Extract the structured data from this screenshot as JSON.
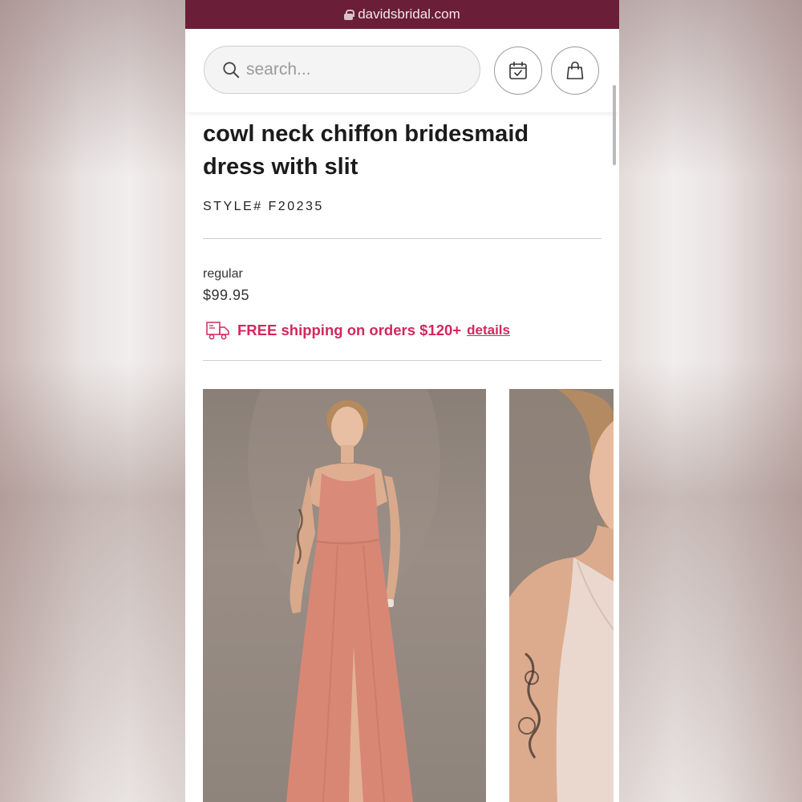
{
  "browser": {
    "url": "davidsbridal.com"
  },
  "header": {
    "search_placeholder": "search...",
    "appointment_icon": "calendar-check-icon",
    "bag_icon": "shopping-bag-icon"
  },
  "product": {
    "title": "cowl neck chiffon bridesmaid dress with slit",
    "style_number": "STYLE# F20235",
    "price_label": "regular",
    "price": "$99.95",
    "shipping_text": "FREE shipping on orders $120+",
    "shipping_link": "details"
  },
  "gallery": {
    "images": [
      {
        "name": "model-full-length-photo",
        "dress_color": "#d98a78"
      },
      {
        "name": "model-closeup-photo",
        "dress_color": "#ead8cf"
      }
    ]
  },
  "colors": {
    "brand_bar": "#6b1e37",
    "accent_pink": "#d2285d"
  }
}
